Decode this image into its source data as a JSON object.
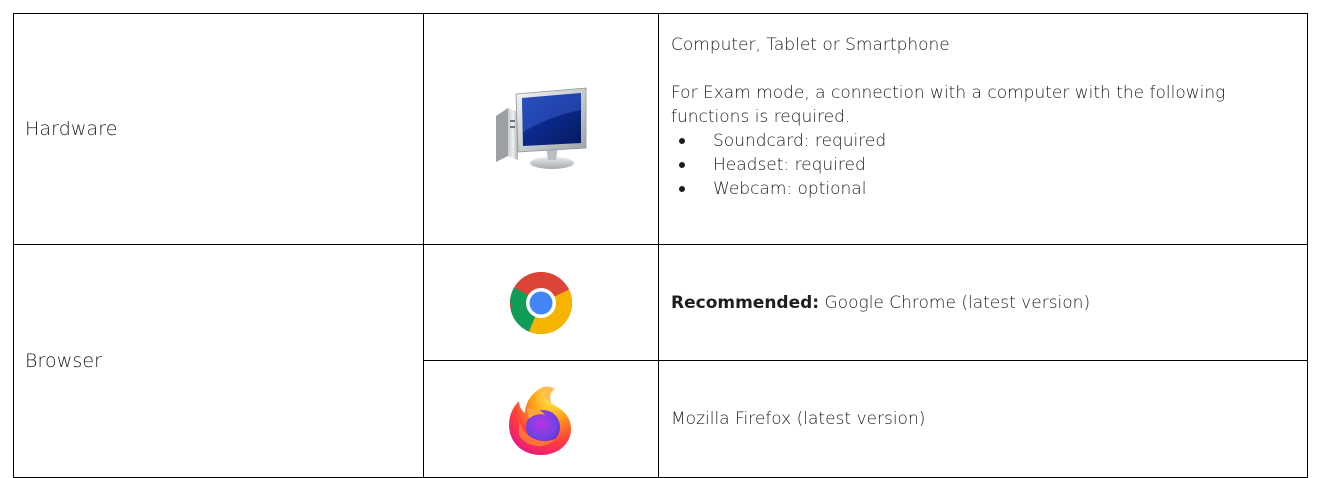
{
  "rows": {
    "hardware": {
      "label": "Hardware",
      "icon": "computer-monitor-icon",
      "line1": "Computer, Tablet or Smartphone",
      "line2": "For Exam mode, a connection with a computer with the following functions is required.",
      "bullets": [
        "Soundcard: required",
        "Headset: required",
        "Webcam: optional"
      ]
    },
    "browser": {
      "label": "Browser",
      "chrome": {
        "icon": "google-chrome-icon",
        "prefix": "Recommended:",
        "text": " Google Chrome (latest version)"
      },
      "firefox": {
        "icon": "mozilla-firefox-icon",
        "text": "Mozilla Firefox (latest version)"
      }
    }
  },
  "colors": {
    "border": "#000000",
    "text": "#1e1e1e"
  }
}
